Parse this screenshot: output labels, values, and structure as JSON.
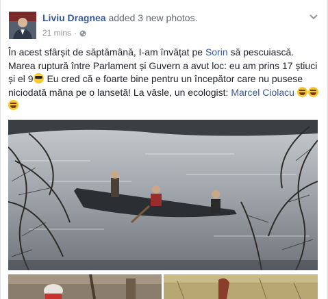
{
  "post": {
    "author": "Liviu Dragnea",
    "action": "added 3 new photos.",
    "time": "21 mins",
    "dot": "·",
    "privacy_icon": "globe-icon",
    "menu_icon": "chevron-down-icon",
    "text_part1": "În acest sfârșit de săptămână, I-am învățat pe ",
    "mention1": "Sorin",
    "text_part2": " să pescuiască. Marea ruptură între Parlament și Guvern a avut loc: eu am prins 17 știuci și el 9",
    "text_part3": " Eu cred că e foarte bine pentru un începător care nu pusese niciodată mâna pe o lansetă! La vâsle, un ecologist: ",
    "mention2": "Marcel Ciolacu",
    "emoji_cool": "smiling-face-with-sunglasses",
    "emoji_laugh": "grinning-face-with-smiling-eyes"
  },
  "photos": [
    {
      "name": "fishing-boat-on-lake-photo"
    },
    {
      "name": "man-holding-fishing-rod-photo"
    },
    {
      "name": "man-holding-fish-photo"
    }
  ],
  "colors": {
    "link": "#365899",
    "text": "#1d2129",
    "meta": "#90949c",
    "border": "#dddfe2"
  }
}
